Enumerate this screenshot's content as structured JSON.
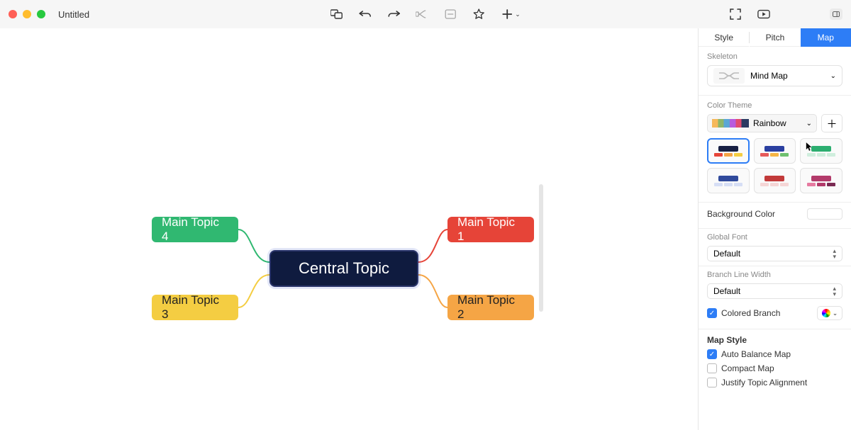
{
  "window": {
    "title": "Untitled"
  },
  "mindmap": {
    "central": "Central Topic",
    "topics": {
      "t1": "Main Topic 1",
      "t2": "Main Topic 2",
      "t3": "Main Topic 3",
      "t4": "Main Topic 4"
    },
    "branch_colors": {
      "t1": "#e64438",
      "t2": "#f5a545",
      "t3": "#f4cd42",
      "t4": "#30b871"
    }
  },
  "panel": {
    "tabs": {
      "style": "Style",
      "pitch": "Pitch",
      "map": "Map"
    },
    "skeleton": {
      "label": "Skeleton",
      "value": "Mind Map"
    },
    "color_theme": {
      "label": "Color Theme",
      "value": "Rainbow"
    },
    "background": {
      "label": "Background Color",
      "value": "#ffffff"
    },
    "global_font": {
      "label": "Global Font",
      "value": "Default"
    },
    "branch_width": {
      "label": "Branch Line Width",
      "value": "Default"
    },
    "colored_branch": {
      "label": "Colored Branch",
      "checked": true
    },
    "map_style": {
      "heading": "Map Style",
      "auto_balance": {
        "label": "Auto Balance Map",
        "checked": true
      },
      "compact": {
        "label": "Compact Map",
        "checked": false
      },
      "justify": {
        "label": "Justify Topic Alignment",
        "checked": false
      }
    }
  }
}
